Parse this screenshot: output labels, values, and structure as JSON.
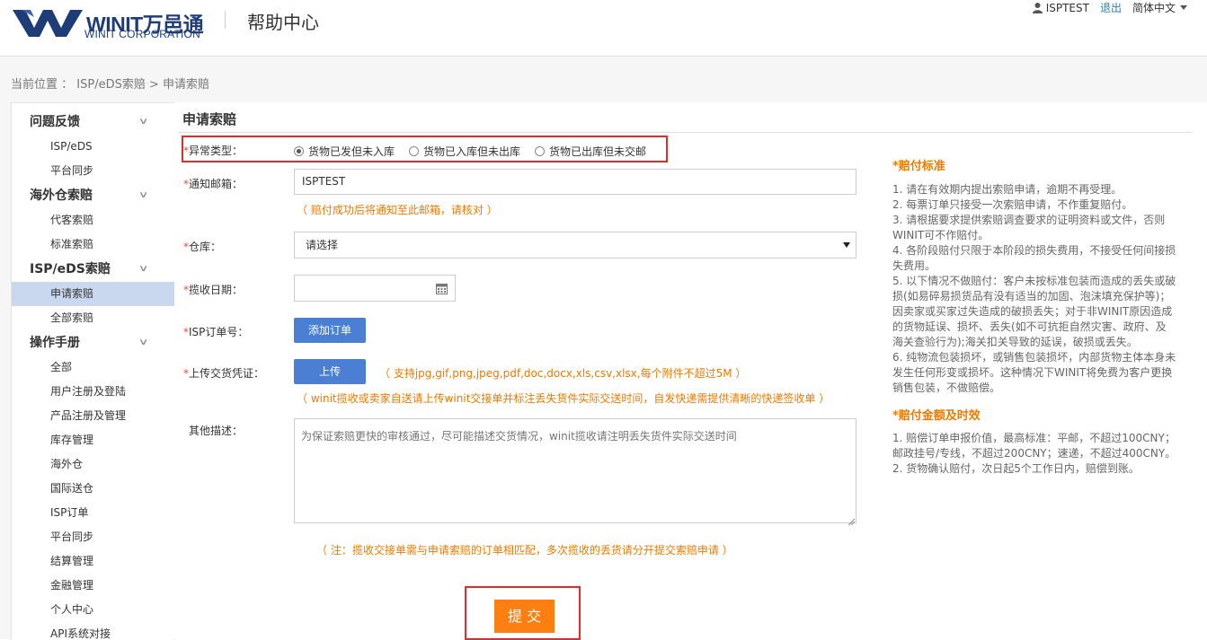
{
  "header": {
    "logo_text": "WINIT万邑通",
    "logo_sub": "WINIT CORPORATION",
    "help_title": "帮助中心",
    "username": "ISPTEST",
    "logout": "退出",
    "language": "简体中文"
  },
  "breadcrumb": "当前位置 ： ISP/eDS索赔 > 申请索赔",
  "sidebar": {
    "groups": [
      {
        "label": "问题反馈",
        "items": [
          "ISP/eDS",
          "平台同步"
        ]
      },
      {
        "label": "海外仓索赔",
        "items": [
          "代客索赔",
          "标准索赔"
        ]
      },
      {
        "label": "ISP/eDS索赔",
        "items": [
          "申请索赔",
          "全部索赔"
        ]
      },
      {
        "label": "操作手册",
        "items": [
          "全部",
          "用户注册及登陆",
          "产品注册及管理",
          "库存管理",
          "海外仓",
          "国际送仓",
          "ISP订单",
          "平台同步",
          "结算管理",
          "金融管理",
          "个人中心",
          "API系统对接"
        ]
      }
    ],
    "active_item": "申请索赔"
  },
  "form": {
    "title": "申请索赔",
    "required_mark": "*",
    "exception_label": "异常类型：",
    "exception_options": [
      "货物已发但未入库",
      "货物已入库但未出库",
      "货物已出库但未交邮"
    ],
    "exception_selected": 0,
    "email_label": "通知邮箱：",
    "email_value": "ISPTEST",
    "email_note": "（ 赔付成功后将通知至此邮箱，请核对 ）",
    "warehouse_label": "仓库：",
    "warehouse_value": "请选择",
    "pickup_date_label": "揽收日期：",
    "pickup_date_value": "",
    "isp_order_label": "ISP订单号：",
    "add_order_button": "添加订单",
    "upload_label": "上传交货凭证：",
    "upload_button": "上传",
    "upload_note1": "（ 支持jpg,gif,png,jpeg,pdf,doc,docx,xls,csv,xlsx,每个附件不超过5M ）",
    "upload_note2": "（ winit揽收或卖家自送请上传winit交接单并标注丢失货件实际交送时间，自发快递需提供清晰的快递签收单 ）",
    "other_label": "其他描述：",
    "other_placeholder": "为保证索赔更快的审核通过，尽可能描述交货情况，winit揽收请注明丢失货件实际交送时间",
    "footnote": "（ 注：揽收交接单需与申请索赔的订单相匹配，多次揽收的丢货请分开提交索赔申请 ）",
    "submit_button": "提 交"
  },
  "info": {
    "standard_title": "*赔付标准",
    "standard_lines": [
      "1. 请在有效期内提出索赔申请，逾期不再受理。",
      "2. 每票订单只接受一次索赔申请，不作重复赔付。",
      "3. 请根据要求提供索赔调查要求的证明资料或文件，否则",
      "WINIT可不作赔付。",
      "4. 各阶段赔付只限于本阶段的损失费用，不接受任何间接损",
      "失费用。",
      "5. 以下情况不做赔付：客户未按标准包装而造成的丢失或破",
      "损(如易碎易损货品有没有适当的加固、泡沫填充保护等)；",
      "因卖家或买家过失造成的破损丢失；对于非WINIT原因造成",
      "的货物延误、损坏、丢失(如不可抗拒自然灾害、政府、及",
      "海关查验行为);海关扣关导致的延误，破损或丢失。",
      "6. 纯物流包装损坏，或销售包装损坏，内部货物主体本身未",
      "发生任何形变或损坏。这种情况下WINIT将免费为客户更换",
      "销售包装，不做赔偿。"
    ],
    "amount_title": "*赔付金额及时效",
    "amount_lines": [
      "1. 赔偿订单申报价值，最高标准：平邮，不超过100CNY；",
      "邮政挂号/专线，不超过200CNY；速递，不超过400CNY。",
      "2. 货物确认赔付，次日起5个工作日内，赔偿到账。"
    ]
  },
  "colors": {
    "brand": "#1e3d78",
    "accent_blue": "#4a7fd4",
    "orange": "#ee7a00",
    "highlight_red": "#e22b2b",
    "active_item": "#c9d7ef"
  }
}
